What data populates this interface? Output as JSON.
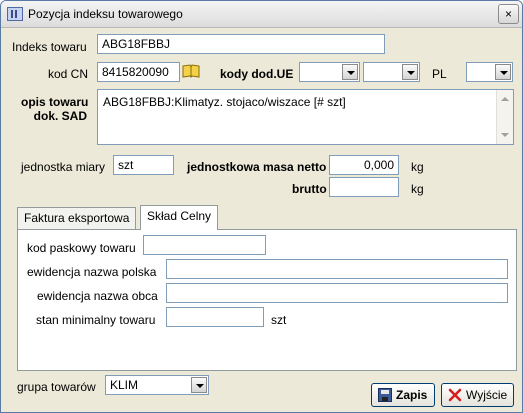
{
  "window": {
    "title": "Pozycja indeksu towarowego",
    "close_glyph": "×"
  },
  "form": {
    "indeks_label": "Indeks towaru",
    "indeks_value": "ABG18FBBJ",
    "kodcn_label": "kod CN",
    "kodcn_value": "8415820090",
    "kody_label": "kody dod.UE",
    "kody1_value": "",
    "kody2_value": "",
    "pl_label": "PL",
    "pl_value": "",
    "opis_label_1": "opis towaru",
    "opis_label_2": "dok. SAD",
    "opis_value": "ABG18FBBJ:Klimatyz. stojaco/wiszace [# szt]",
    "jm_label": "jednostka miary",
    "jm_value": "szt",
    "masa_netto_label": "jednostkowa masa netto",
    "masa_netto_value": "0,000",
    "masa_unit": "kg",
    "brutto_label": "brutto",
    "brutto_value": "",
    "brutto_unit": "kg"
  },
  "tabs": [
    {
      "label": "Faktura eksportowa",
      "active": false
    },
    {
      "label": "Skład Celny",
      "active": true
    }
  ],
  "sklad": {
    "kod_paskowy_label": "kod paskowy towaru",
    "kod_paskowy_value": "",
    "ew_polska_label": "ewidencja nazwa polska",
    "ew_polska_value": "",
    "ew_obca_label": "ewidencja nazwa obca",
    "ew_obca_value": "",
    "stan_label": "stan minimalny towaru",
    "stan_value": "",
    "stan_unit": "szt"
  },
  "footer": {
    "grupa_label": "grupa towarów",
    "grupa_value": "KLIM",
    "save_label": "Zapis",
    "exit_label": "Wyjście"
  },
  "colors": {
    "exit_icon": "#d32020",
    "save_icon": "#3b5a9a",
    "book_icon": "#d8b000"
  }
}
